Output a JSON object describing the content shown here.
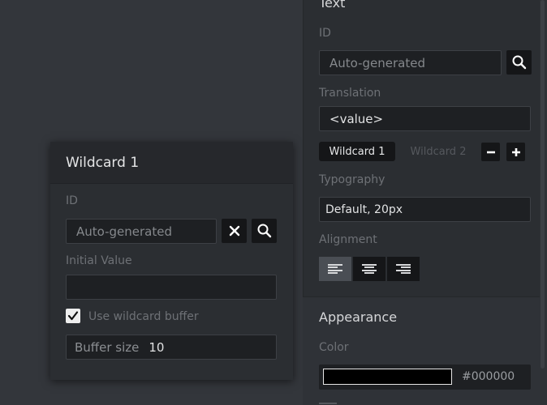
{
  "popup": {
    "title": "Wildcard 1",
    "id_label": "ID",
    "id_placeholder": "Auto-generated",
    "initial_value_label": "Initial Value",
    "initial_value": "",
    "use_buffer_label": "Use wildcard buffer",
    "use_buffer_checked": true,
    "buffer_size_label": "Buffer size",
    "buffer_size_value": "10"
  },
  "props": {
    "section_title": "Text",
    "id_label": "ID",
    "id_placeholder": "Auto-generated",
    "translation_label": "Translation",
    "translation_value": "<value>",
    "wildcard_tabs": [
      "Wildcard 1",
      "Wildcard 2"
    ],
    "active_wildcard_index": 0,
    "typography_label": "Typography",
    "typography_value": "Default, 20px",
    "alignment_label": "Alignment",
    "alignment_options": [
      "left",
      "center",
      "right"
    ],
    "active_alignment": "left",
    "appearance_title": "Appearance",
    "color_label": "Color",
    "color_hex": "#000000",
    "color_swatch": "#000000"
  },
  "icons": {
    "clear": "x-icon",
    "search": "magnifier-icon",
    "remove": "minus-icon",
    "add": "plus-icon",
    "check": "checkmark-icon"
  }
}
